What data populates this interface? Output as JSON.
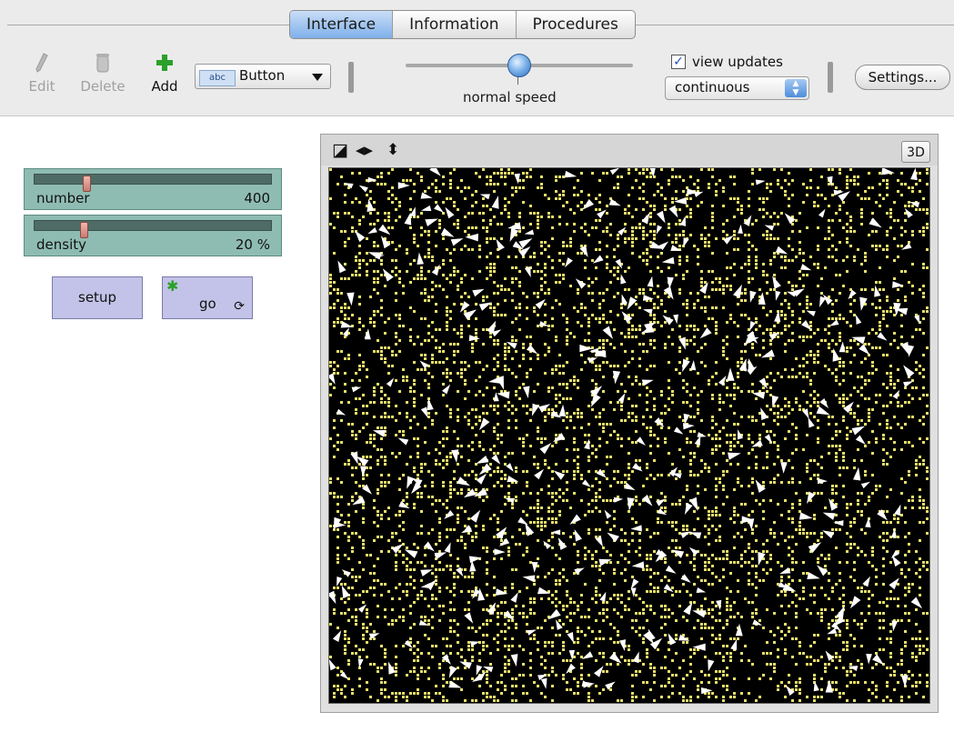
{
  "tabs": [
    {
      "label": "Interface",
      "active": true
    },
    {
      "label": "Information",
      "active": false
    },
    {
      "label": "Procedures",
      "active": false
    }
  ],
  "toolbar": {
    "edit_label": "Edit",
    "delete_label": "Delete",
    "add_label": "Add",
    "widget_type_badge": "abc",
    "widget_type": "Button",
    "speed_label": "normal speed",
    "speed_value": 0.5,
    "view_updates_label": "view updates",
    "view_updates_checked": true,
    "update_mode": "continuous",
    "settings_label": "Settings..."
  },
  "sliders": [
    {
      "name": "number",
      "value": "400",
      "position": 0.21
    },
    {
      "name": "density",
      "value": "20 %",
      "position": 0.2
    }
  ],
  "buttons": {
    "setup_label": "setup",
    "go_label": "go",
    "go_forever": true
  },
  "view": {
    "three_d_label": "3D",
    "background_color": "#000000",
    "patch_color": "#e8e06a",
    "turtle_color": "#ffffff",
    "patch_density_percent": 20,
    "turtle_count": 400
  },
  "colors": {
    "tab_active": "#7fb0ea",
    "slider_bg": "#8fbcb2",
    "button_bg": "#c3c3e9",
    "add_icon": "#2aa12a"
  }
}
